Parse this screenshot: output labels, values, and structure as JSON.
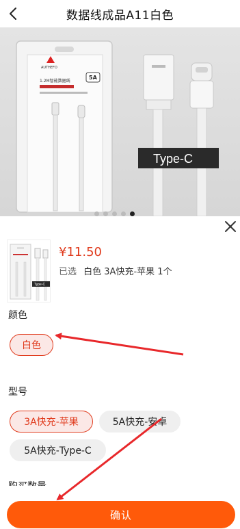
{
  "header": {
    "title": "数据线成品A11白色"
  },
  "banner": {
    "type_label": "Type-C",
    "box_amp": "5A",
    "brand": "AUTHEFO",
    "box_title": "1.2M智能数据线",
    "slides_total": 5,
    "slides_active": 5
  },
  "product": {
    "price": "¥11.50",
    "selected_prefix": "已选",
    "selected_spec": "白色 3A快充-苹果",
    "selected_count": "1个",
    "thumb_label": "Type-C"
  },
  "color_section": {
    "label": "颜色",
    "options": [
      "白色"
    ],
    "selected": "白色"
  },
  "model_section": {
    "label": "型号",
    "options": [
      "3A快充-苹果",
      "5A快充-安卓",
      "5A快充-Type-C"
    ],
    "selected": "3A快充-苹果"
  },
  "quantity_section": {
    "label": "购买数量"
  },
  "confirm_button": {
    "label": "确认"
  },
  "colors": {
    "accent": "#e03a1c",
    "confirm": "#ff5a0a",
    "annotation_arrow": "#e8282b"
  }
}
